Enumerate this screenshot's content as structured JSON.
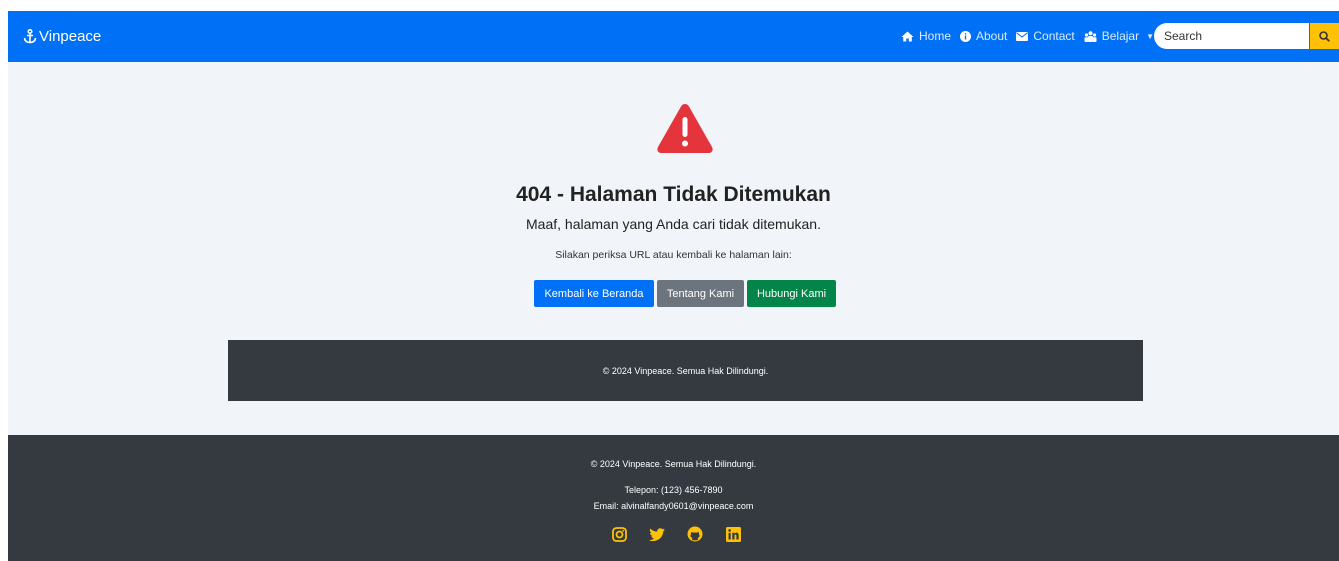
{
  "navbar": {
    "brand": "Vinpeace",
    "links": [
      {
        "label": "Home",
        "icon": "home-icon"
      },
      {
        "label": "About",
        "icon": "info-icon"
      },
      {
        "label": "Contact",
        "icon": "envelope-icon"
      },
      {
        "label": "Belajar",
        "icon": "people-icon"
      }
    ],
    "search_placeholder": "Search",
    "accent_color": "#0070f6",
    "search_button_color": "#ffc107"
  },
  "error": {
    "icon": "warning-triangle-icon",
    "title": "404 - Halaman Tidak Ditemukan",
    "subtitle": "Maaf, halaman yang Anda cari tidak ditemukan.",
    "hint": "Silakan periksa URL atau kembali ke halaman lain:",
    "buttons": {
      "home": "Kembali ke Beranda",
      "about": "Tentang Kami",
      "contact": "Hubungi Kami"
    }
  },
  "inner_footer": {
    "copyright": "© 2024 Vinpeace. Semua Hak Dilindungi."
  },
  "footer": {
    "copyright": "© 2024 Vinpeace. Semua Hak Dilindungi.",
    "phone": "Telepon: (123) 456-7890",
    "email": "Email: alvinalfandy0601@vinpeace.com",
    "socials": [
      "instagram-icon",
      "twitter-icon",
      "github-icon",
      "linkedin-icon"
    ],
    "social_color": "#ffc107"
  }
}
